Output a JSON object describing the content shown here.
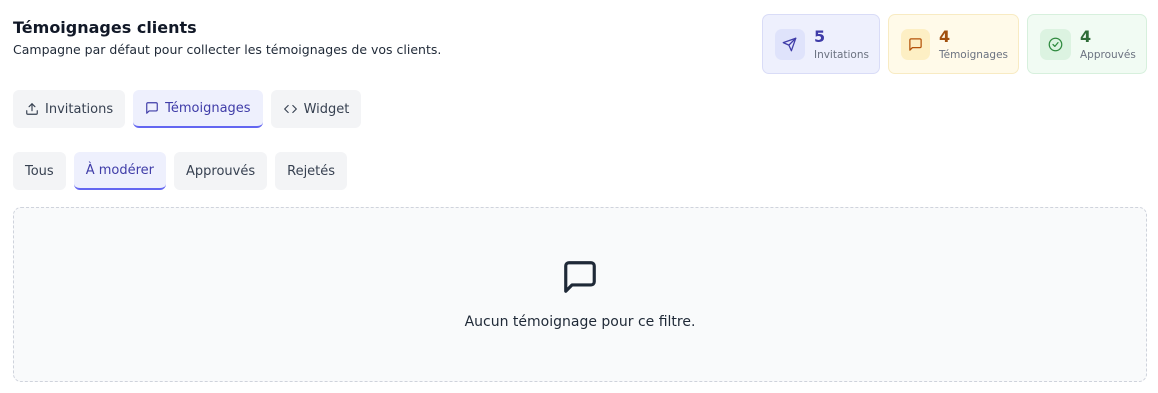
{
  "header": {
    "title": "Témoignages clients",
    "subtitle": "Campagne par défaut pour collecter les témoignages de vos clients."
  },
  "stats": [
    {
      "value": "5",
      "label": "Invitations",
      "icon": "send-icon",
      "color": "#3f3ca8"
    },
    {
      "value": "4",
      "label": "Témoignages",
      "icon": "message-square-icon",
      "color": "#a1500e"
    },
    {
      "value": "4",
      "label": "Approuvés",
      "icon": "check-circle-icon",
      "color": "#2f6c37"
    }
  ],
  "tabs": [
    {
      "label": "Invitations",
      "icon": "upload-icon",
      "active": false
    },
    {
      "label": "Témoignages",
      "icon": "message-square-icon",
      "active": true
    },
    {
      "label": "Widget",
      "icon": "code-icon",
      "active": false
    }
  ],
  "filters": [
    {
      "label": "Tous",
      "active": false
    },
    {
      "label": "À modérer",
      "active": true
    },
    {
      "label": "Approuvés",
      "active": false
    },
    {
      "label": "Rejetés",
      "active": false
    }
  ],
  "empty_state": {
    "icon": "message-square-icon",
    "message": "Aucun témoignage pour ce filtre."
  },
  "colors": {
    "accent": "#6366f1",
    "accent_text": "#3f3ca8"
  }
}
